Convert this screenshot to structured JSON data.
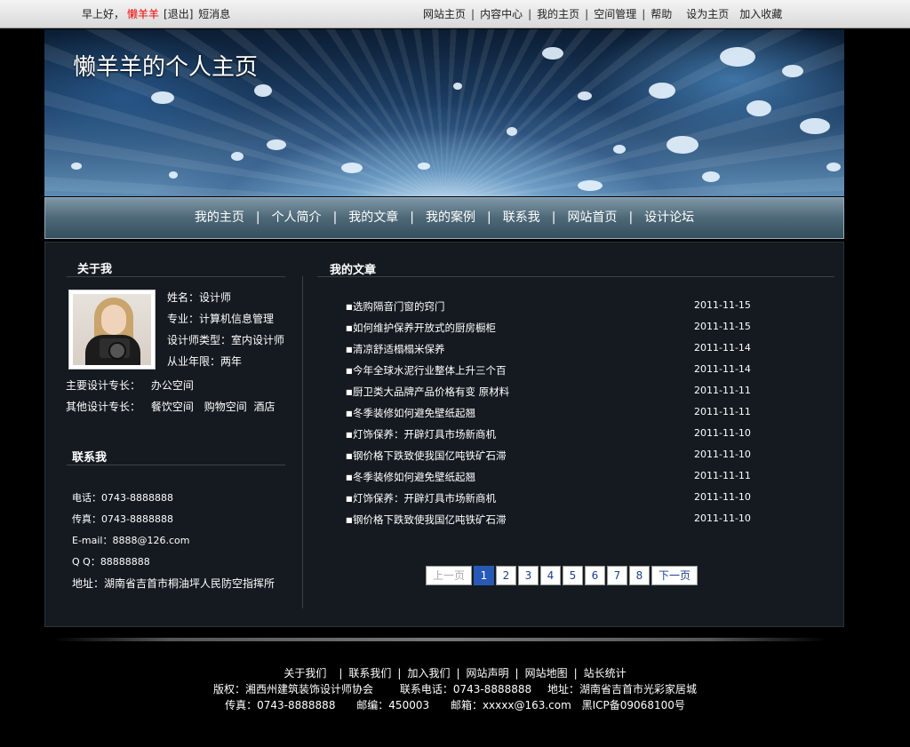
{
  "topbar": {
    "greeting": "早上好，",
    "username": "懒羊羊",
    "logout": "[退出]",
    "messages": "短消息",
    "links": [
      "网站主页",
      "内容中心",
      "我的主页",
      "空间管理",
      "帮助"
    ],
    "set_home": "设为主页",
    "favorite": "加入收藏"
  },
  "banner": {
    "title": "懒羊羊的个人主页"
  },
  "nav": {
    "items": [
      "我的主页",
      "个人简介",
      "我的文章",
      "我的案例",
      "联系我",
      "网站首页",
      "设计论坛"
    ],
    "separator": "|"
  },
  "about": {
    "title": "关于我",
    "name": "姓名：设计师",
    "major": "专业：计算机信息管理",
    "type": "设计师类型：室内设计师",
    "years": "从业年限：两年",
    "main_spec_label": "主要设计专长：",
    "main_spec": "办公空间",
    "other_spec_label": "其他设计专长：",
    "other_spec": [
      "餐饮空间",
      "购物空间",
      "酒店"
    ]
  },
  "contact": {
    "title": "联系我",
    "phone": "电话：0743-8888888",
    "fax": "传真：0743-8888888",
    "email": "E-mail：8888@126.com",
    "qq": "Q  Q：88888888",
    "address": "地址：湖南省吉首市桐油坪人民防空指挥所"
  },
  "articles": {
    "title": "我的文章",
    "items": [
      {
        "title": "选购隔音门窗的窍门",
        "date": "2011-11-15"
      },
      {
        "title": "如何维护保养开放式的厨房橱柜",
        "date": "2011-11-15"
      },
      {
        "title": "清凉舒适榻榻米保养",
        "date": "2011-11-14"
      },
      {
        "title": "今年全球水泥行业整体上升三个百",
        "date": "2011-11-14"
      },
      {
        "title": "厨卫类大品牌产品价格有变 原材料",
        "date": "2011-11-11"
      },
      {
        "title": "冬季装修如何避免壁纸起翘",
        "date": "2011-11-11"
      },
      {
        "title": "灯饰保养：开辟灯具市场新商机",
        "date": "2011-11-10"
      },
      {
        "title": "钢价格下跌致使我国亿吨铁矿石滞",
        "date": "2011-11-10"
      },
      {
        "title": "冬季装修如何避免壁纸起翘",
        "date": "2011-11-11"
      },
      {
        "title": "灯饰保养：开辟灯具市场新商机",
        "date": "2011-11-10"
      },
      {
        "title": "钢价格下跌致使我国亿吨铁矿石滞",
        "date": "2011-11-10"
      }
    ]
  },
  "pager": {
    "prev": "上一页",
    "pages": [
      "1",
      "2",
      "3",
      "4",
      "5",
      "6",
      "7",
      "8"
    ],
    "current": "1",
    "next": "下一页"
  },
  "footer": {
    "links": [
      "关于我们",
      "联系我们",
      "加入我们",
      "网站声明",
      "网站地图",
      "站长统计"
    ],
    "copyright": "版权：湘西州建筑装饰设计师协会",
    "phone": "联系电话：0743-8888888",
    "address": "地址：湖南省吉首市光彩家居城",
    "fax": "传真：0743-8888888",
    "postcode": "邮编：450003",
    "email": "邮箱：xxxxx@163.com",
    "icp": "黑ICP备09068100号"
  },
  "colors": {
    "accent": "#2859b5",
    "username": "#e00000",
    "background": "#000000",
    "panel": "#141a20"
  }
}
